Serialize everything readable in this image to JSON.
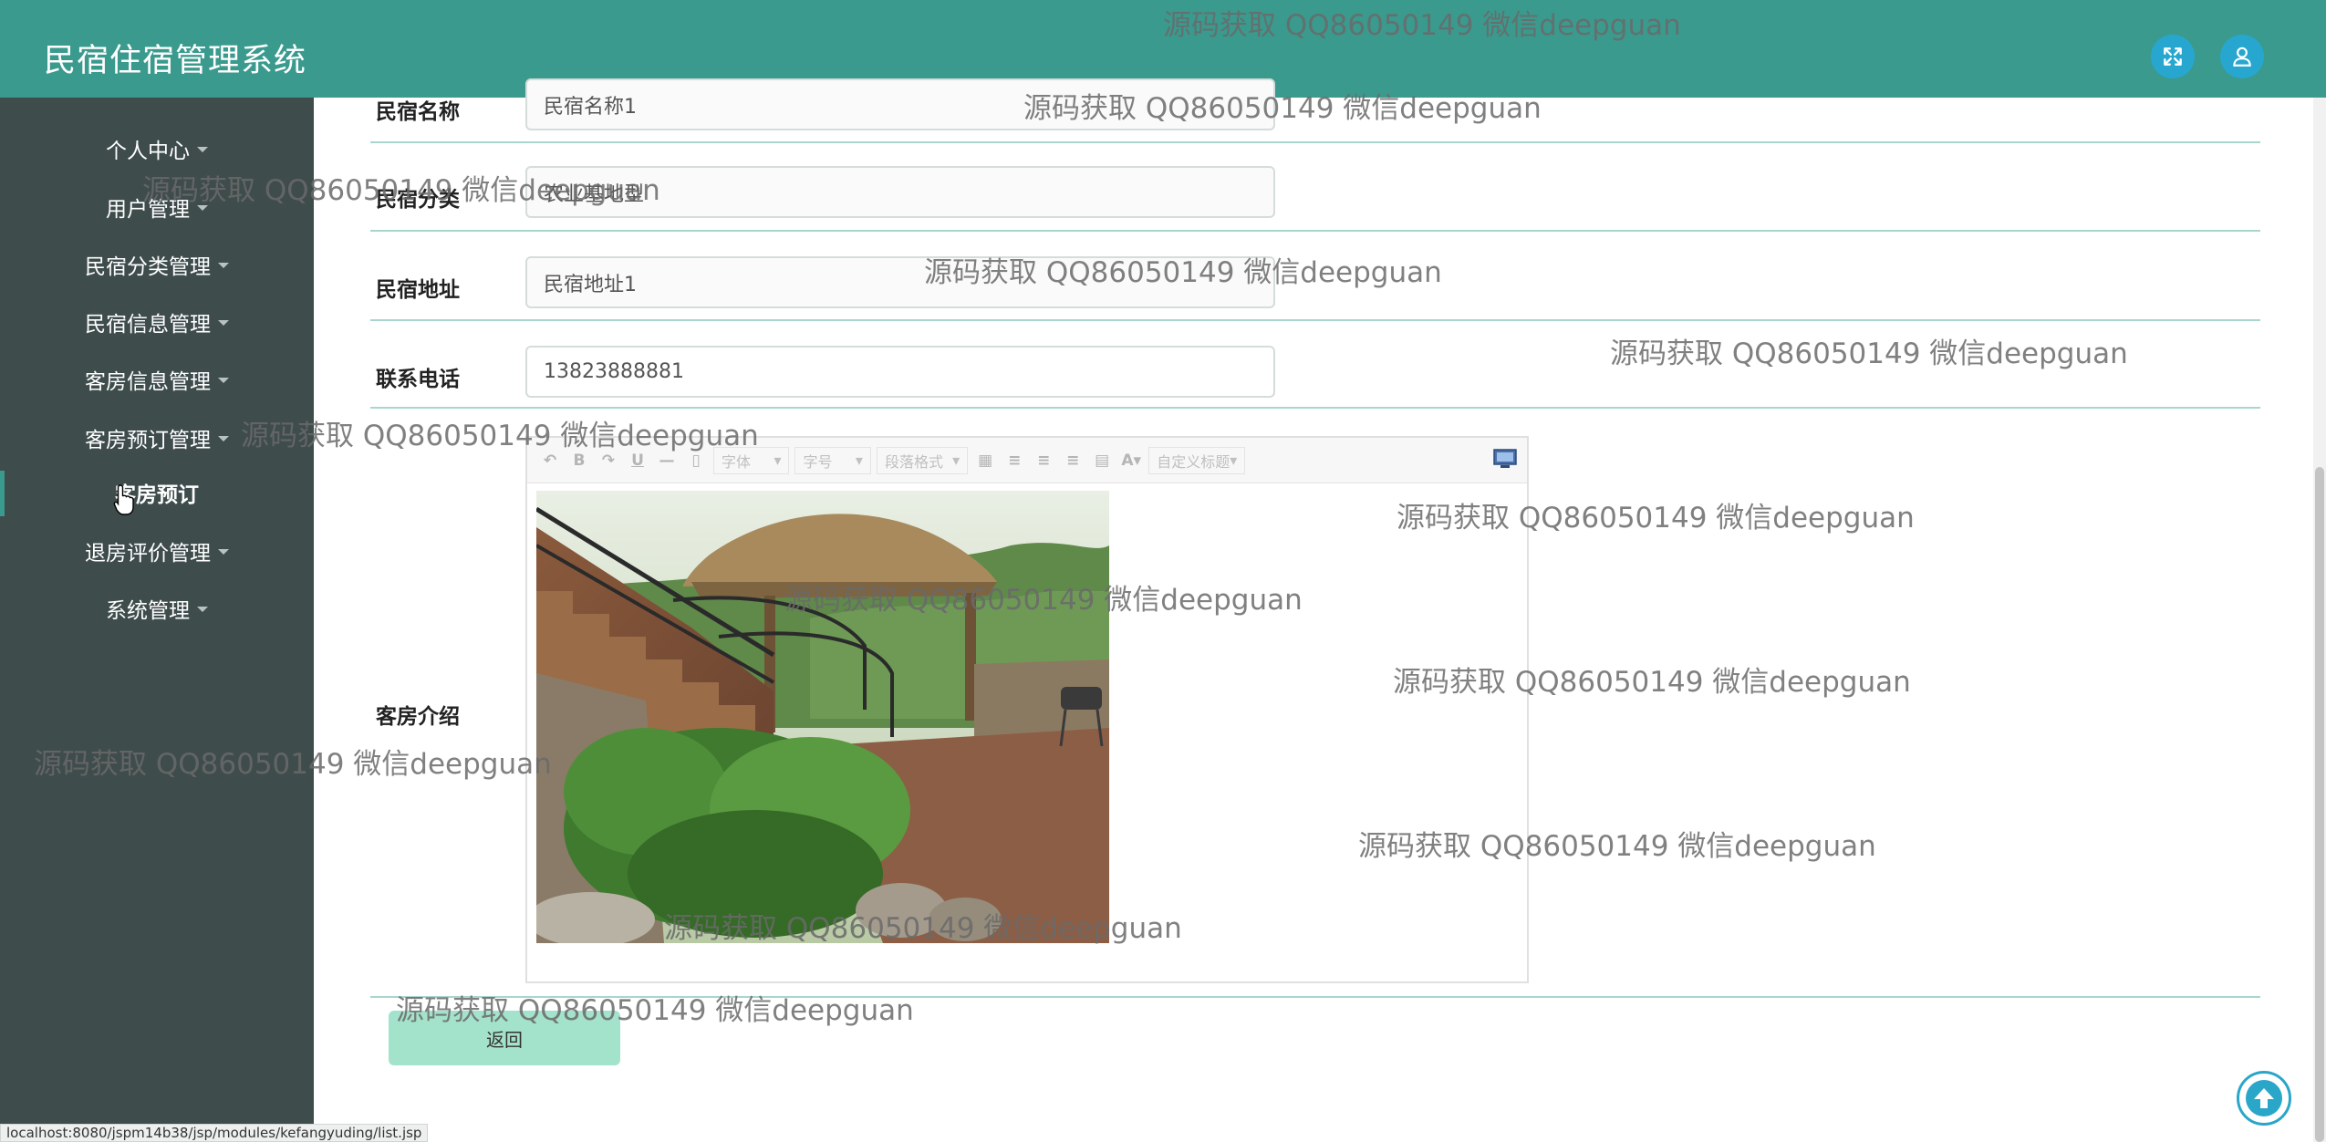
{
  "app": {
    "title": "民宿住宿管理系统"
  },
  "header": {
    "fullscreen_icon": "fullscreen-icon",
    "user_icon": "user-icon"
  },
  "sidebar": {
    "items": [
      {
        "label": "个人中心",
        "has_caret": true
      },
      {
        "label": "用户管理",
        "has_caret": true
      },
      {
        "label": "民宿分类管理",
        "has_caret": true
      },
      {
        "label": "民宿信息管理",
        "has_caret": true
      },
      {
        "label": "客房信息管理",
        "has_caret": true
      },
      {
        "label": "客房预订管理",
        "has_caret": true
      },
      {
        "label": "客房预订",
        "active": true
      },
      {
        "label": "退房评价管理",
        "has_caret": true
      },
      {
        "label": "系统管理",
        "has_caret": true
      }
    ]
  },
  "form": {
    "homestay_name": {
      "label": "民宿名称",
      "value": "民宿名称1"
    },
    "homestay_category": {
      "label": "民宿分类",
      "value": "农业基地型"
    },
    "homestay_address": {
      "label": "民宿地址",
      "value": "民宿地址1"
    },
    "phone": {
      "label": "联系电话",
      "value": "13823888881"
    },
    "room_intro": {
      "label": "客房介绍"
    }
  },
  "editor": {
    "font_select": "字体",
    "size_select": "字号",
    "paragraph_select": "段落格式",
    "custom_title_select": "自定义标题",
    "bold": "B",
    "underline": "U",
    "font_color": "A"
  },
  "actions": {
    "back_label": "返回"
  },
  "status_bar": {
    "url": "localhost:8080/jspm14b38/jsp/modules/kefangyuding/list.jsp"
  },
  "watermark": {
    "text": "源码获取 QQ86050149 微信deepguan"
  },
  "colors": {
    "header_bg": "#3a9a8e",
    "sidebar_bg": "#3f4c4c",
    "accent_blue": "#27a7cf",
    "back_button": "#a4e3cb"
  }
}
